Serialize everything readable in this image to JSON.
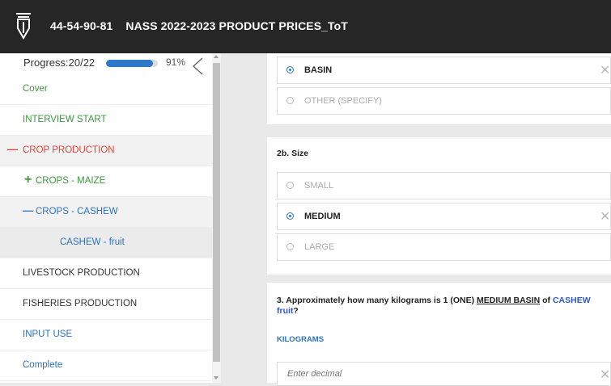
{
  "header": {
    "logo_icon": "pen-nib-logo-icon",
    "id": "44-54-90-81",
    "title": "NASS 2022-2023 PRODUCT PRICES_ToT"
  },
  "sidebar": {
    "progress_label": "Progress:20/22",
    "progress_percent": "91%",
    "progress_value": 0.91,
    "items": [
      {
        "label": "Cover"
      },
      {
        "label": "INTERVIEW START"
      },
      {
        "symbol": "—",
        "label": "CROP PRODUCTION"
      },
      {
        "symbol": "+",
        "label": "CROPS - MAIZE"
      },
      {
        "symbol": "—",
        "label": "CROPS - CASHEW"
      },
      {
        "label": "CASHEW - fruit"
      },
      {
        "label": "LIVESTOCK PRODUCTION"
      },
      {
        "label": "FISHERIES PRODUCTION"
      },
      {
        "label": "INPUT USE"
      },
      {
        "label": "Complete"
      }
    ]
  },
  "main": {
    "unit_options": [
      {
        "label": "BASIN",
        "selected": true
      },
      {
        "label": "OTHER (SPECIFY)",
        "selected": false
      }
    ],
    "size_question": "2b. Size",
    "size_options": [
      {
        "label": "SMALL",
        "selected": false
      },
      {
        "label": "MEDIUM",
        "selected": true
      },
      {
        "label": "LARGE",
        "selected": false
      }
    ],
    "q3": {
      "prefix": "3. Approximately how many kilograms is 1 (ONE) ",
      "underlined": "MEDIUM BASIN",
      "middle": " of ",
      "highlight": "CASHEW fruit",
      "suffix": "?"
    },
    "units_label": "KILOGRAMS",
    "decimal_placeholder": "Enter decimal",
    "clear_symbol": "✕"
  },
  "colors": {
    "header_bg": "#262626",
    "progress": "#2e78c9",
    "green": "#3a9a3a",
    "red": "#e0463a",
    "blue": "#2b72c4"
  }
}
